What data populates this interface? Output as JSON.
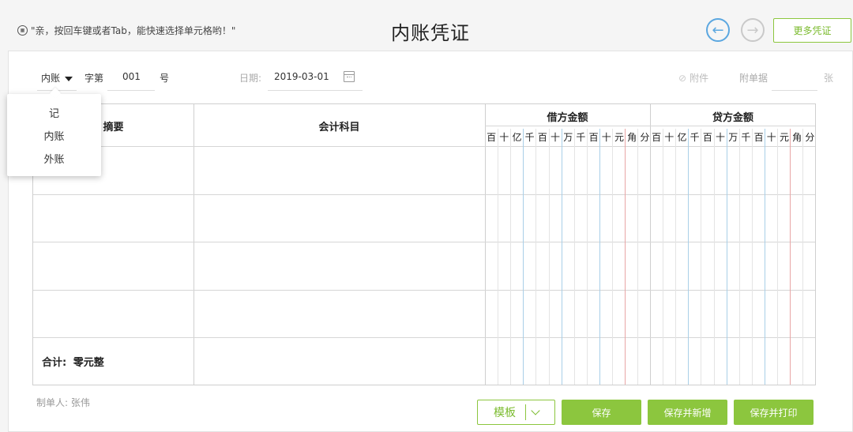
{
  "topbar": {
    "tip_icon": "keyboard-icon",
    "tip_text": "\"亲，按回车键或者Tab，能快速选择单元格哟！\"",
    "title": "内账凭证",
    "prev_icon": "←",
    "next_icon": "→",
    "more_label": "更多凭证"
  },
  "voucher": {
    "ledger_type": "内账",
    "zi_di": "字第",
    "number": "001",
    "hao": "号",
    "date_label": "日期:",
    "date_value": "2019-03-01",
    "attach_icon": "⊘",
    "attach_label": "附件",
    "fudan_label": "附单据",
    "zhang": "张"
  },
  "table": {
    "col_summary": "摘要",
    "col_account": "会计科目",
    "col_debit": "借方金额",
    "col_credit": "贷方金额",
    "debit_digits": [
      "百",
      "十",
      "亿",
      "千",
      "百",
      "十",
      "万",
      "千",
      "百",
      "十",
      "元",
      "角",
      "分"
    ],
    "credit_digits": [
      "百",
      "十",
      "亿",
      "千",
      "百",
      "十",
      "万",
      "千",
      "百",
      "十",
      "元",
      "角",
      "分"
    ],
    "total_label": "合计:",
    "total_value": "零元整"
  },
  "dropdown": {
    "options": [
      "记",
      "内账",
      "外账"
    ]
  },
  "footer": {
    "maker_label": "制单人:",
    "maker_name": "张伟",
    "template_label": "模板",
    "save_label": "保存",
    "save_new_label": "保存并新增",
    "save_print_label": "保存并打印"
  },
  "colors": {
    "accent_green": "#8cc63e",
    "nav_blue": "#5ba7e0"
  }
}
